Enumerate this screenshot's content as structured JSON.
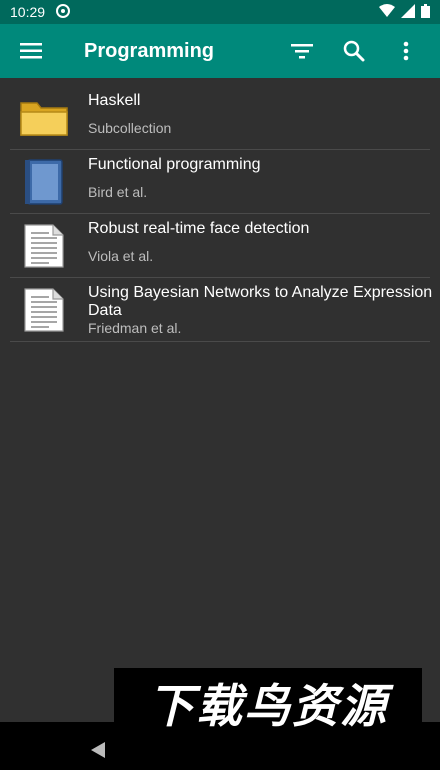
{
  "status": {
    "time": "10:29"
  },
  "appbar": {
    "title": "Programming",
    "menu_icon": "hamburger-menu-icon",
    "filter_icon": "filter-icon",
    "search_icon": "search-icon",
    "more_icon": "more-vertical-icon"
  },
  "items": [
    {
      "title": "Haskell",
      "subtitle": "Subcollection",
      "icon": "folder-icon"
    },
    {
      "title": "Functional programming",
      "subtitle": "Bird et al.",
      "icon": "book-icon"
    },
    {
      "title": "Robust real-time face detection",
      "subtitle": "Viola et al.",
      "icon": "document-icon"
    },
    {
      "title": "Using Bayesian Networks to Analyze Expression Data",
      "subtitle": "Friedman et al.",
      "icon": "document-icon"
    }
  ],
  "watermark": "下载鸟资源",
  "colors": {
    "status_bar": "#00695c",
    "app_bar": "#00897b",
    "background": "#303030"
  }
}
